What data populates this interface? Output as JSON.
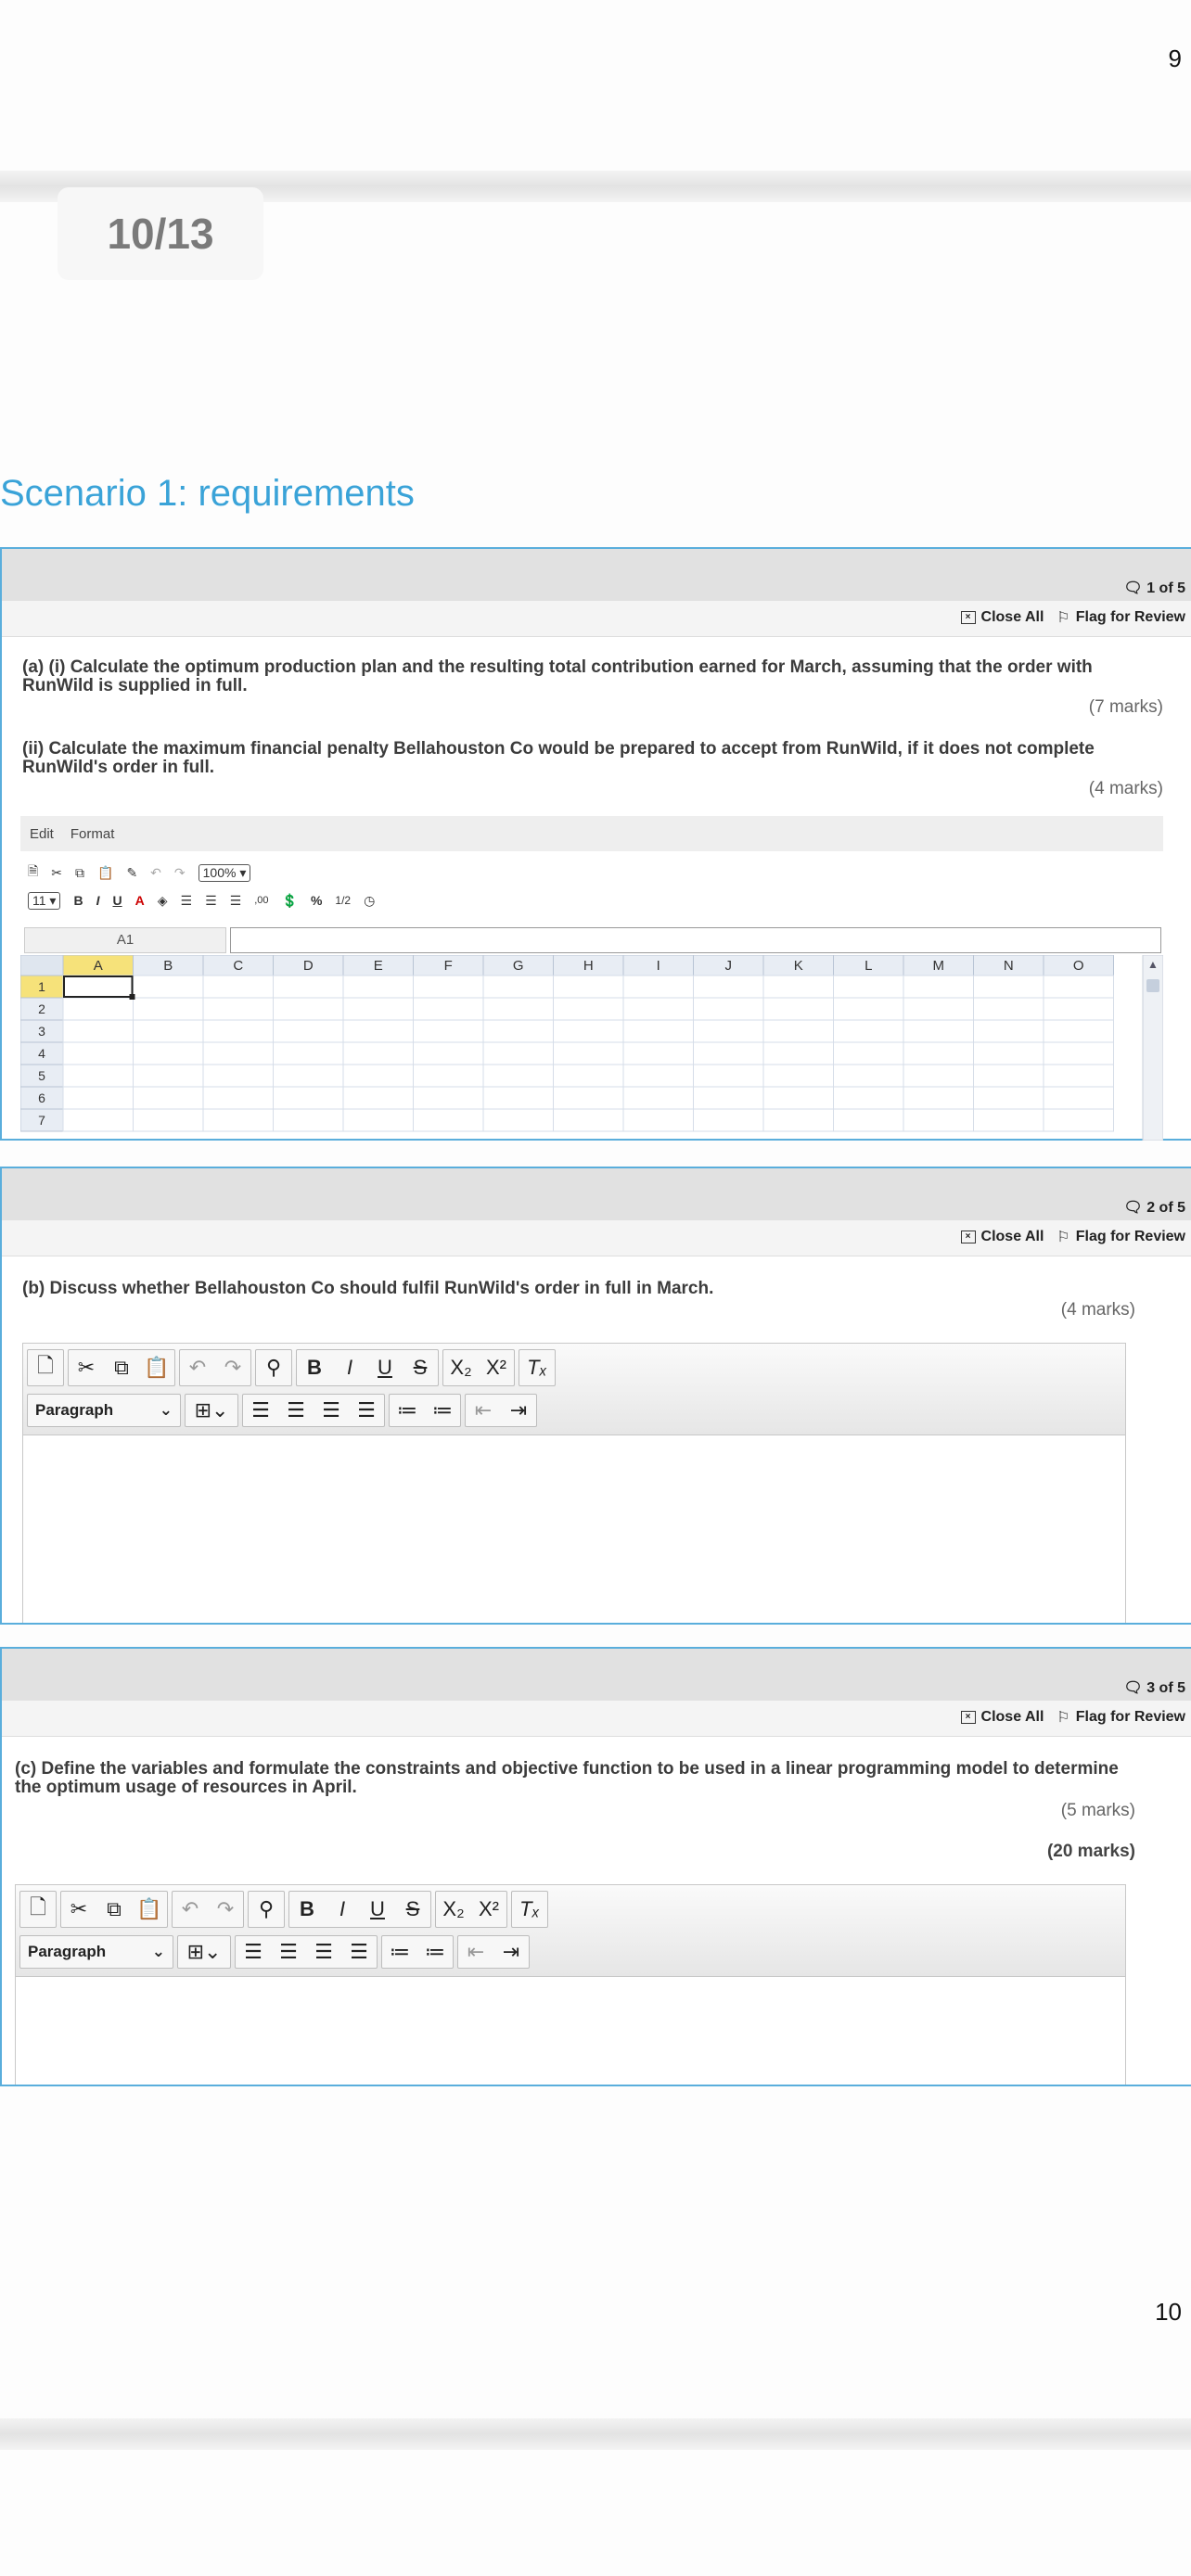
{
  "pages": {
    "top_number": "9",
    "bottom_number": "10",
    "indicator": "10/13"
  },
  "scenario": {
    "title": "Scenario 1: requirements"
  },
  "toolbar": {
    "close_all": "Close All",
    "flag_review": "Flag for Review"
  },
  "q1": {
    "count": "1 of 5",
    "part_a": "(a) (i) Calculate the optimum production plan and the resulting total contribution earned for March, assuming that the order with RunWild is supplied in full.",
    "marks_a": "(7 marks)",
    "part_aii": "(ii) Calculate the maximum financial penalty Bellahouston Co would be prepared to accept from RunWild, if it does not complete RunWild's order in full.",
    "marks_aii": "(4 marks)"
  },
  "spreadsheet": {
    "menu": [
      "Edit",
      "Format"
    ],
    "zoom": "100%",
    "font_size": "11",
    "cell_ref": "A1",
    "columns": [
      "A",
      "B",
      "C",
      "D",
      "E",
      "F",
      "G",
      "H",
      "I",
      "J",
      "K",
      "L",
      "M",
      "N",
      "O"
    ],
    "rows": [
      "1",
      "2",
      "3",
      "4",
      "5",
      "6",
      "7"
    ]
  },
  "q2": {
    "count": "2 of 5",
    "part_b": "(b) Discuss whether Bellahouston Co should fulfil RunWild's order in full in March.",
    "marks_b": "(4 marks)"
  },
  "q3": {
    "count": "3 of 5",
    "part_c": "(c) Define the variables and formulate the constraints and objective function to be used in a linear programming model to determine the optimum usage of resources in April.",
    "marks_c": "(5 marks)",
    "total": "(20 marks)"
  },
  "editor": {
    "paragraph_label": "Paragraph"
  },
  "colors": {
    "accent": "#3aa3d8",
    "panel_border": "#5aaedc",
    "selected_header": "#f6e27a"
  }
}
